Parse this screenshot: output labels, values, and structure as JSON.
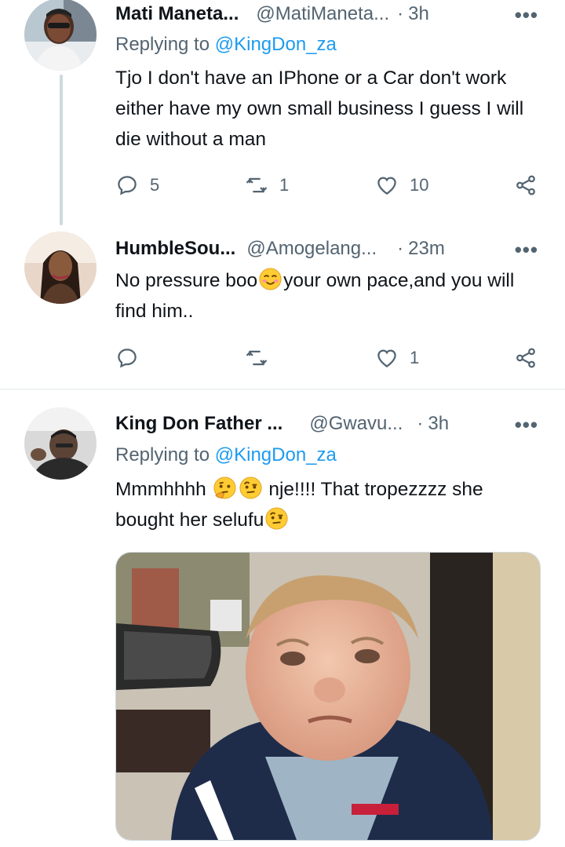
{
  "tweets": [
    {
      "name": "Mati Maneta...",
      "handle": "@MatiManeta...",
      "time": "3h",
      "replying_prefix": "Replying to ",
      "replying_to": "@KingDon_za",
      "text": "Tjo I don't have an IPhone or a Car don't work either have my own small business I guess I will die without a man",
      "reply_count": "5",
      "retweet_count": "1",
      "like_count": "10"
    },
    {
      "name": "HumbleSou...",
      "handle": "@Amogelang...",
      "time": "23m",
      "text_before_emoji": "No pressure boo",
      "emoji": "smiling-face-blushing",
      "text_after_emoji": "your own pace,and you will find him..",
      "reply_count": "",
      "retweet_count": "",
      "like_count": "1"
    },
    {
      "name": "King Don Father ...",
      "handle": "@Gwavu...",
      "time": "3h",
      "replying_prefix": "Replying to ",
      "replying_to": "@KingDon_za",
      "text_part1": "Mmmhhhh",
      "emojis_1": [
        "thinking-face",
        "face-with-raised-eyebrow"
      ],
      "text_part2": "nje!!!! That tropezzzz she bought her selufu",
      "emojis_2": [
        "face-with-raised-eyebrow"
      ],
      "media": "photo-crying-child"
    }
  ],
  "colors": {
    "text": "#0f1419",
    "secondary": "#536471",
    "link": "#1d9bf0",
    "thread_line": "#cfd9de",
    "divider": "#eff3f4"
  },
  "icons": [
    "reply-icon",
    "retweet-icon",
    "like-icon",
    "share-icon",
    "more-icon"
  ],
  "more_label": "•••",
  "dot_label": "·"
}
